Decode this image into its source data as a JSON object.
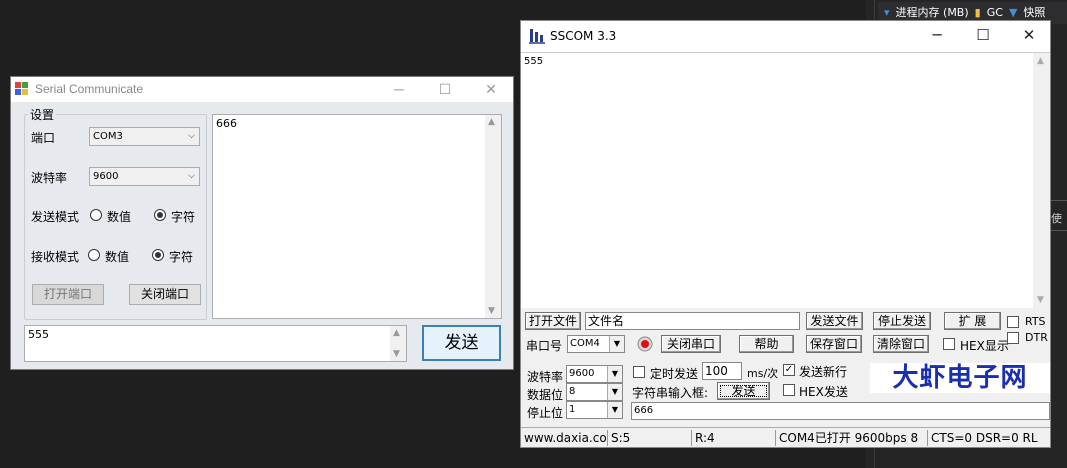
{
  "background_panel": {
    "header_items": [
      "进程内存 (MB)",
      "GC",
      "快照"
    ],
    "side_text": "使"
  },
  "serial_window": {
    "title": "Serial Communicate",
    "group_title": "设置",
    "port_label": "端口",
    "port_value": "COM3",
    "baud_label": "波特率",
    "baud_value": "9600",
    "send_mode_label": "发送模式",
    "recv_mode_label": "接收模式",
    "option_numeric": "数值",
    "option_char": "字符",
    "open_port_button": "打开端口",
    "close_port_button": "关闭端口",
    "receive_text": "666",
    "send_input_value": "555",
    "send_button": "发送"
  },
  "sscom_window": {
    "title": "SSCOM 3.3",
    "receive_text": "555",
    "open_file_button": "打开文件",
    "file_name_value": "文件名",
    "send_file_button": "发送文件",
    "stop_send_button": "停止发送",
    "expand_button": "扩 展",
    "rts_label": "RTS",
    "dtr_label": "DTR",
    "port_label": "串口号",
    "port_value": "COM4",
    "close_port_button": "关闭串口",
    "help_button": "帮助",
    "save_window_button": "保存窗口",
    "clear_window_button": "清除窗口",
    "hex_display_label": "HEX显示",
    "baud_label": "波特率",
    "baud_value": "9600",
    "databits_label": "数据位",
    "databits_value": "8",
    "stopbits_label": "停止位",
    "stopbits_value": "1",
    "timed_send_label": "定时发送",
    "interval_value": "100",
    "interval_unit": "ms/次",
    "send_newline_label": "发送新行",
    "string_input_label": "字符串输入框:",
    "send_button": "发送",
    "hex_send_label": "HEX发送",
    "send_input_value": "666",
    "logo_text": "大虾电子网",
    "status": {
      "website": "www.daxia.com",
      "sent": "S:5",
      "received": "R:4",
      "port_state": "COM4已打开  9600bps  8",
      "lines": "CTS=0 DSR=0 RL"
    }
  },
  "colors": {
    "accent_blue": "#1a2fb0",
    "send_button_border": "#3c7fb1",
    "dark_background": "#1f1f1f"
  }
}
